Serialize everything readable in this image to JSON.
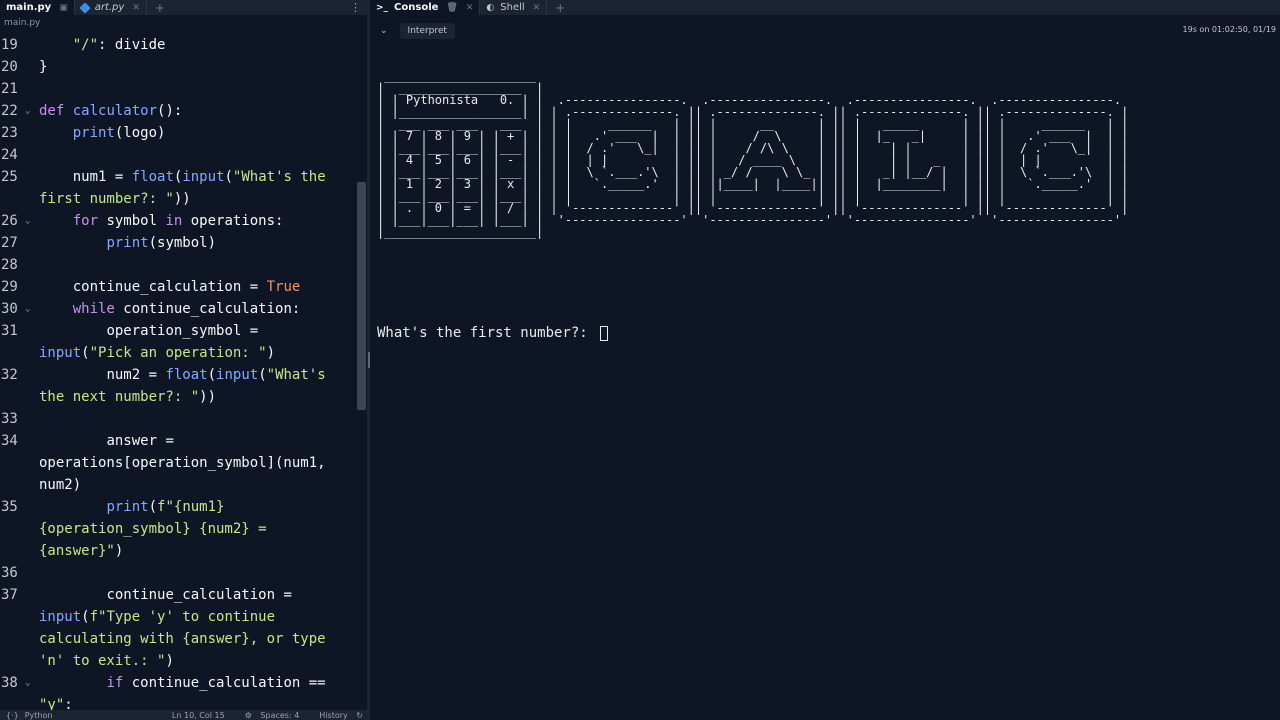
{
  "editor": {
    "tabs": [
      {
        "label": "main.py",
        "active": true
      },
      {
        "label": "art.py",
        "active": false
      }
    ],
    "breadcrumb": "main.py",
    "lines": [
      {
        "num": "19",
        "fold": false,
        "html": "    <span class=\"str\">\"/\"</span>: divide"
      },
      {
        "num": "20",
        "fold": false,
        "html": "}"
      },
      {
        "num": "21",
        "fold": false,
        "html": ""
      },
      {
        "num": "22",
        "fold": true,
        "html": "<span class=\"kw\">def</span> <span class=\"fn\">calculator</span>():"
      },
      {
        "num": "23",
        "fold": false,
        "html": "    <span class=\"bi\">print</span>(logo)"
      },
      {
        "num": "24",
        "fold": false,
        "html": ""
      },
      {
        "num": "25",
        "fold": false,
        "html": "    num1 = <span class=\"bi\">float</span>(<span class=\"bi\">input</span>(<span class=\"str\">\"What's the first number?: \"</span>))"
      },
      {
        "num": "26",
        "fold": true,
        "html": "    <span class=\"kw\">for</span> symbol <span class=\"kw\">in</span> operations:"
      },
      {
        "num": "27",
        "fold": false,
        "html": "        <span class=\"bi\">print</span>(symbol)"
      },
      {
        "num": "28",
        "fold": false,
        "html": ""
      },
      {
        "num": "29",
        "fold": false,
        "html": "    continue_calculation = <span class=\"cst\">True</span>"
      },
      {
        "num": "30",
        "fold": true,
        "html": "    <span class=\"kw\">while</span> continue_calculation:"
      },
      {
        "num": "31",
        "fold": false,
        "html": "        operation_symbol = <span class=\"bi\">input</span>(<span class=\"str\">\"Pick an operation: \"</span>)"
      },
      {
        "num": "32",
        "fold": false,
        "html": "        num2 = <span class=\"bi\">float</span>(<span class=\"bi\">input</span>(<span class=\"str\">\"What's the next number?: \"</span>))"
      },
      {
        "num": "33",
        "fold": false,
        "html": ""
      },
      {
        "num": "34",
        "fold": false,
        "html": "        answer = operations[operation_symbol](num1, num2)"
      },
      {
        "num": "35",
        "fold": false,
        "html": "        <span class=\"bi\">print</span>(<span class=\"str\">f\"{num1} {operation_symbol} {num2} = {answer}\"</span>)"
      },
      {
        "num": "36",
        "fold": false,
        "html": ""
      },
      {
        "num": "37",
        "fold": false,
        "html": "        continue_calculation = <span class=\"bi\">input</span>(<span class=\"str\">f\"Type 'y' to continue calculating with {answer}, or type 'n' to exit.: \"</span>)"
      },
      {
        "num": "38",
        "fold": true,
        "html": "        <span class=\"kw\">if</span> continue_calculation == <span class=\"str\">\"y\"</span>:"
      }
    ],
    "status": {
      "language": "Python",
      "position": "Ln 10, Col 15",
      "spaces": "Spaces: 4",
      "history": "History"
    }
  },
  "console": {
    "tabs": [
      {
        "label": "Console",
        "active": true
      },
      {
        "label": "Shell",
        "active": false
      }
    ],
    "interpreter_chip": "Interpret",
    "run_info": "19s on 01:02:50, 01/19",
    "output": " _____________________\n|  _________________  |\n| | Pythonista   0. | |  .----------------.  .----------------.  .----------------.  .----------------.\n| |_________________| | | .--------------. || .--------------. || .--------------. || .--------------. |\n|  ___ ___ ___   ___  | | |     ______   | || |      __      | || |   _____      | || |     ______   | |\n| | 7 | 8 | 9 | | + | | | |   .' ___  |  | || |     /  \\     | || |  |_   _|     | || |   .' ___  |  | |\n| |___|___|___| |___| | | |  / .'   \\_|  | || |    / /\\ \\    | || |    | |       | || |  / .'   \\_|  | |\n| | 4 | 5 | 6 | | - | | | |  | |         | || |   / ____ \\   | || |    | |   _   | || |  | |         | |\n| |___|___|___| |___| | | |  \\ `.___.'\\  | || | _/ /    \\ \\_ | || |   _| |__/ |  | || |  \\ `.___.'\\  | |\n| | 1 | 2 | 3 | | x | | | |   `._____.'  | || ||____|  |____|| || |  |________|  | || |   `._____.'  | |\n| |___|___|___| |___| | | |              | || |              | || |              | || |              | |\n| | . | 0 | = | | / | | | '--------------' || '--------------' || '--------------' || '--------------' |\n| |___|___|___| |___| |  '----------------'  '----------------'  '----------------'  '----------------'\n|_____________________|",
    "prompt": "What's the first number?: "
  }
}
